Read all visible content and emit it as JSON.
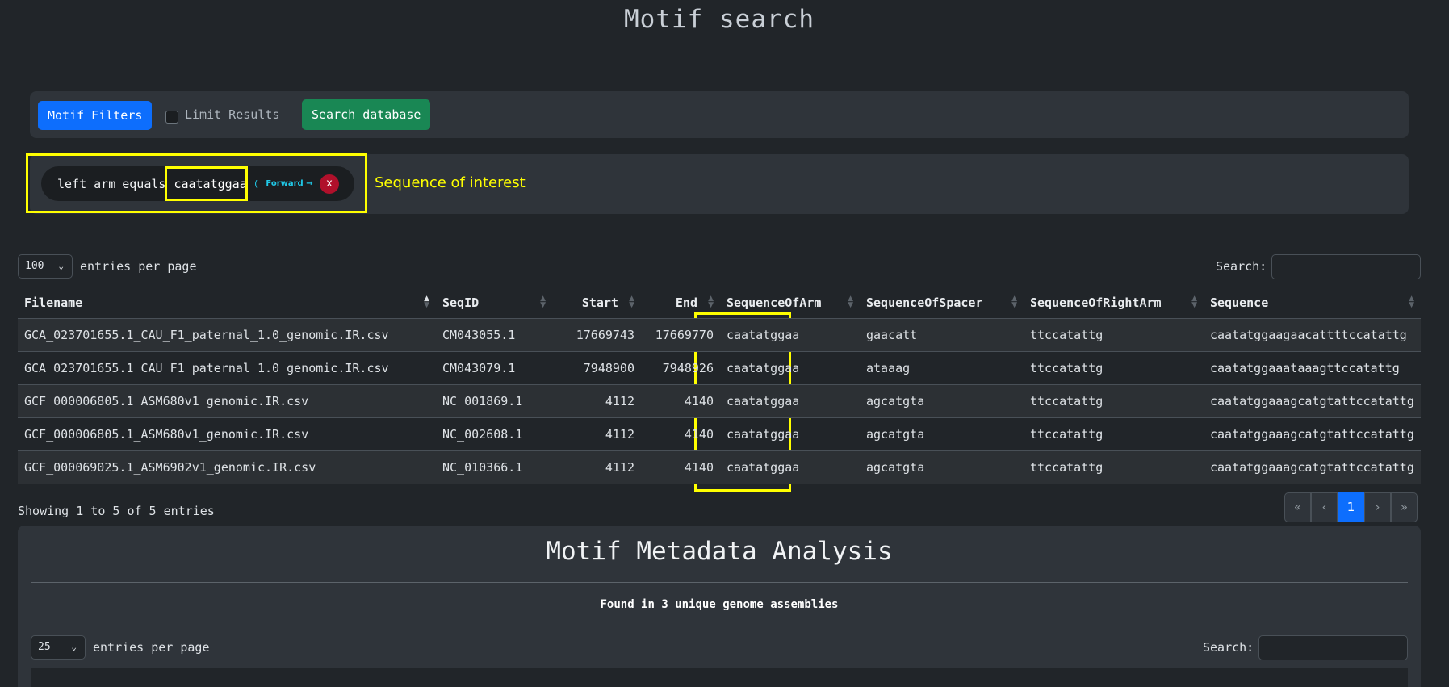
{
  "page_title": "Motif search",
  "filter_bar": {
    "motif_filters_label": "Motif Filters",
    "limit_results_label": "Limit Results",
    "limit_results_checked": false,
    "search_database_label": "Search database"
  },
  "active_filter": {
    "field": "left_arm",
    "operator": "equals",
    "value": "caatatggaa",
    "direction_open": "(",
    "direction": "Forward →",
    "direction_close": ")",
    "remove_label": "x"
  },
  "annotation": {
    "label": "Sequence of interest",
    "color": "#ffff00"
  },
  "results": {
    "page_length": "100",
    "page_length_suffix": "entries per page",
    "search_label": "Search:",
    "search_value": "",
    "columns": [
      "Filename",
      "SeqID",
      "Start",
      "End",
      "SequenceOfArm",
      "SequenceOfSpacer",
      "SequenceOfRightArm",
      "Sequence"
    ],
    "rows": [
      [
        "GCA_023701655.1_CAU_F1_paternal_1.0_genomic.IR.csv",
        "CM043055.1",
        "17669743",
        "17669770",
        "caatatggaa",
        "gaacatt",
        "ttccatattg",
        "caatatggaagaacattttccatattg"
      ],
      [
        "GCA_023701655.1_CAU_F1_paternal_1.0_genomic.IR.csv",
        "CM043079.1",
        "7948900",
        "7948926",
        "caatatggaa",
        "ataaag",
        "ttccatattg",
        "caatatggaaataaagttccatattg"
      ],
      [
        "GCF_000006805.1_ASM680v1_genomic.IR.csv",
        "NC_001869.1",
        "4112",
        "4140",
        "caatatggaa",
        "agcatgta",
        "ttccatattg",
        "caatatggaaagcatgtattccatattg"
      ],
      [
        "GCF_000006805.1_ASM680v1_genomic.IR.csv",
        "NC_002608.1",
        "4112",
        "4140",
        "caatatggaa",
        "agcatgta",
        "ttccatattg",
        "caatatggaaagcatgtattccatattg"
      ],
      [
        "GCF_000069025.1_ASM6902v1_genomic.IR.csv",
        "NC_010366.1",
        "4112",
        "4140",
        "caatatggaa",
        "agcatgta",
        "ttccatattg",
        "caatatggaaagcatgtattccatattg"
      ]
    ],
    "info": "Showing 1 to 5 of 5 entries",
    "pagination": [
      "«",
      "‹",
      "1",
      "›",
      "»"
    ],
    "current_page": "1"
  },
  "metadata": {
    "title": "Motif Metadata Analysis",
    "subtitle": "Found in 3 unique genome assemblies",
    "page_length": "25",
    "page_length_suffix": "entries per page",
    "search_label": "Search:"
  },
  "colors": {
    "background": "#212529",
    "panel": "#2f343a",
    "primary": "#0d6efd",
    "success": "#198754",
    "danger": "#b0102b",
    "highlight": "#ffff00"
  }
}
